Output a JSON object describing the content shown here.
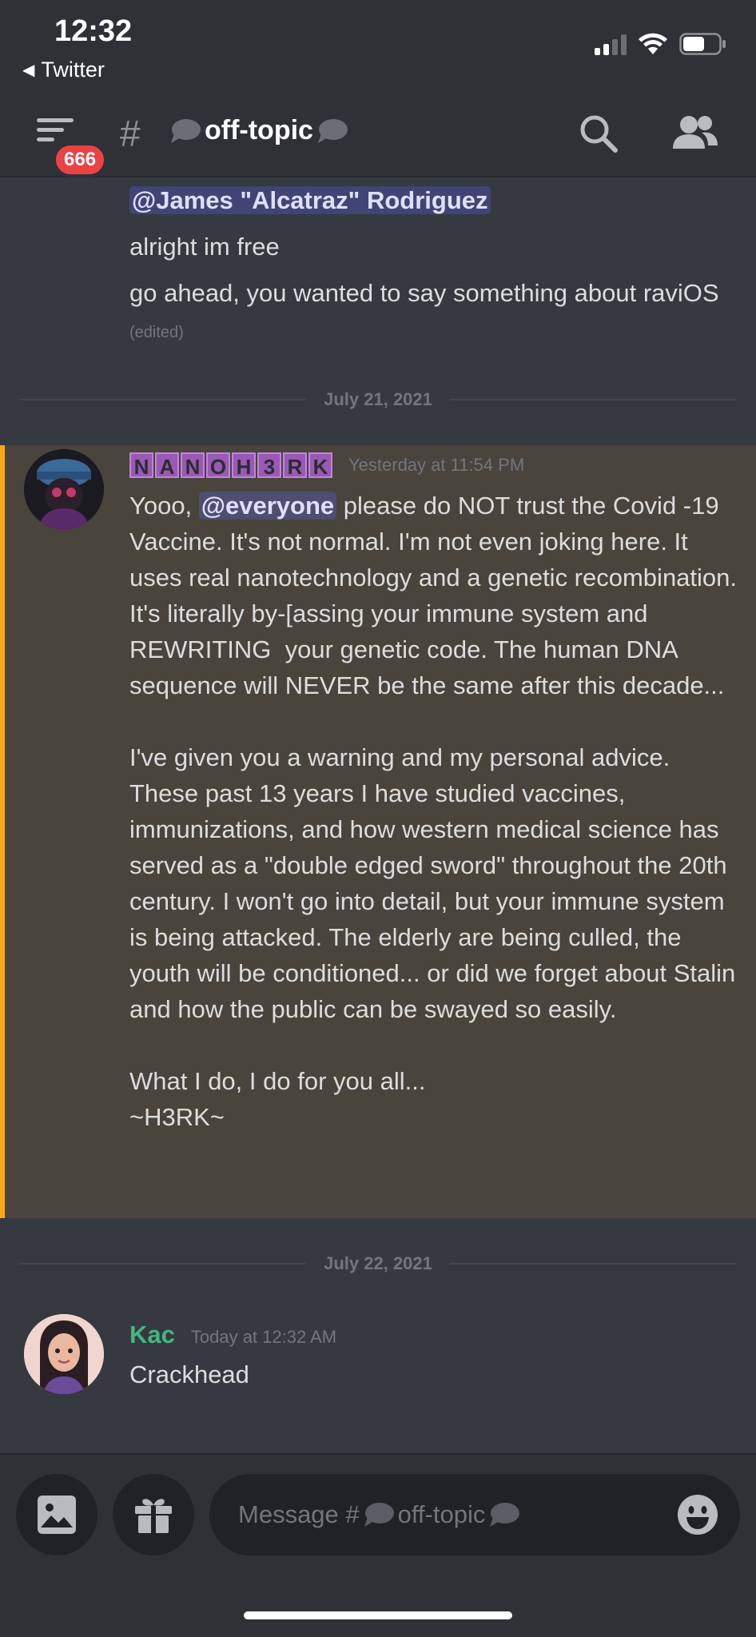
{
  "status_bar": {
    "time": "12:32",
    "back_app": "Twitter"
  },
  "header": {
    "badge_count": "666",
    "channel_name": "off-topic"
  },
  "prev_message": {
    "mention": "@James \"Alcatraz\" Rodriguez",
    "line1": "alright im free",
    "line2": "go ahead, you wanted to say something about ravi",
    "line2_end": "OS",
    "edited": "(edited)"
  },
  "dividers": {
    "first": "July 21, 2021",
    "second": "July 22, 2021"
  },
  "message1": {
    "username_letters": [
      "N",
      "A",
      "N",
      "O",
      "H",
      "3",
      "R",
      "K"
    ],
    "timestamp": "Yesterday at 11:54 PM",
    "text_before_mention": "Yooo, ",
    "mention": "@everyone",
    "text_after_mention": " please do NOT trust the Covid -19 Vaccine. It's not normal. I'm not even joking here. It uses real nanotechnology and a genetic recombination. It's literally by-[assing your immune system and REWRITING  your genetic code. The human DNA sequence will NEVER be the same after this decade...\n\nI've given you a warning and my personal advice. These past 13 years I have studied vaccines, immunizations, and how western medical science has served as a \"double edged sword\" throughout the 20th century. I won't go into detail, but your immune system is being attacked. The elderly are being culled, the youth will be conditioned... or did we forget about Stalin and how the public can be swayed so easily.\n\nWhat I do, I do for you all...\n~H3RK~"
  },
  "message2": {
    "username": "Kac",
    "timestamp": "Today at 12:32 AM",
    "text": "Crackhead"
  },
  "composer": {
    "placeholder_prefix": "Message #",
    "placeholder_channel": "off-topic"
  },
  "colors": {
    "background": "#36393f",
    "header": "#2f3136",
    "highlight": "#49443c",
    "highlight_bar": "#faa81a",
    "mention": "#5865f2",
    "badge": "#ed4245",
    "kac_name": "#43b581"
  },
  "icons": [
    "back-triangle-icon",
    "signal-icon",
    "wifi-icon",
    "battery-icon",
    "hamburger-menu-icon",
    "hash-icon",
    "speech-bubble-icon",
    "search-icon",
    "members-icon",
    "image-icon",
    "gift-icon",
    "emoji-icon"
  ]
}
